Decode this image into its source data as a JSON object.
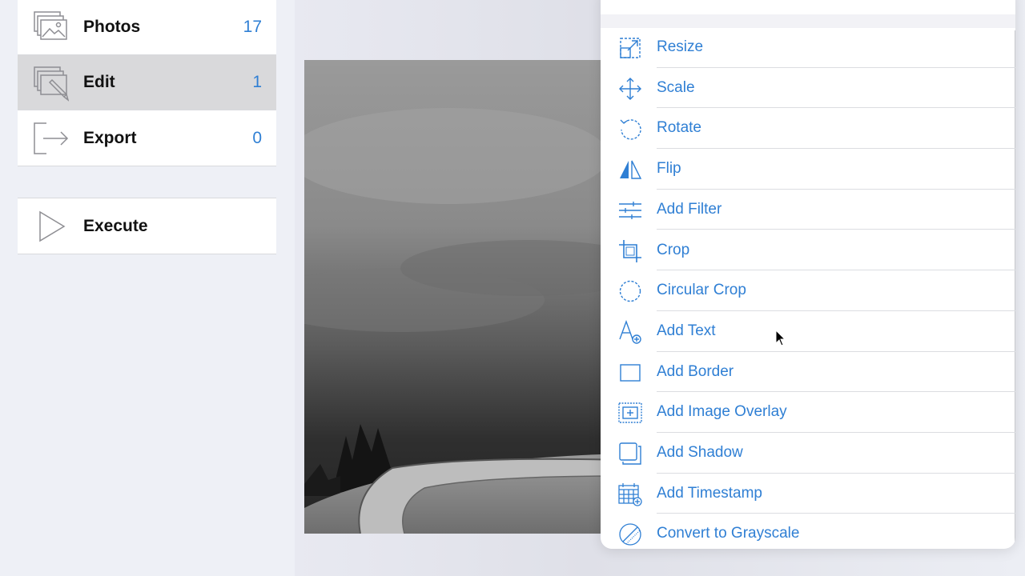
{
  "sidebar": {
    "items": [
      {
        "label": "Photos",
        "count": "17",
        "icon": "photos-icon"
      },
      {
        "label": "Edit",
        "count": "1",
        "icon": "edit-icon"
      },
      {
        "label": "Export",
        "count": "0",
        "icon": "export-icon"
      }
    ],
    "execute": {
      "label": "Execute",
      "icon": "play-icon"
    }
  },
  "menu": {
    "items": [
      {
        "label": "Resize",
        "icon": "resize-icon"
      },
      {
        "label": "Scale",
        "icon": "scale-icon"
      },
      {
        "label": "Rotate",
        "icon": "rotate-icon"
      },
      {
        "label": "Flip",
        "icon": "flip-icon"
      },
      {
        "label": "Add Filter",
        "icon": "filter-sliders-icon"
      },
      {
        "label": "Crop",
        "icon": "crop-icon"
      },
      {
        "label": "Circular Crop",
        "icon": "circular-crop-icon"
      },
      {
        "label": "Add Text",
        "icon": "add-text-icon"
      },
      {
        "label": "Add Border",
        "icon": "border-icon"
      },
      {
        "label": "Add Image Overlay",
        "icon": "image-overlay-icon"
      },
      {
        "label": "Add Shadow",
        "icon": "shadow-icon"
      },
      {
        "label": "Add Timestamp",
        "icon": "timestamp-calendar-icon"
      },
      {
        "label": "Convert to Grayscale",
        "icon": "grayscale-icon"
      }
    ]
  },
  "colors": {
    "accent": "#2f7fd4",
    "selected_row": "#d9d9db",
    "icon_gray": "#8e8e93"
  }
}
